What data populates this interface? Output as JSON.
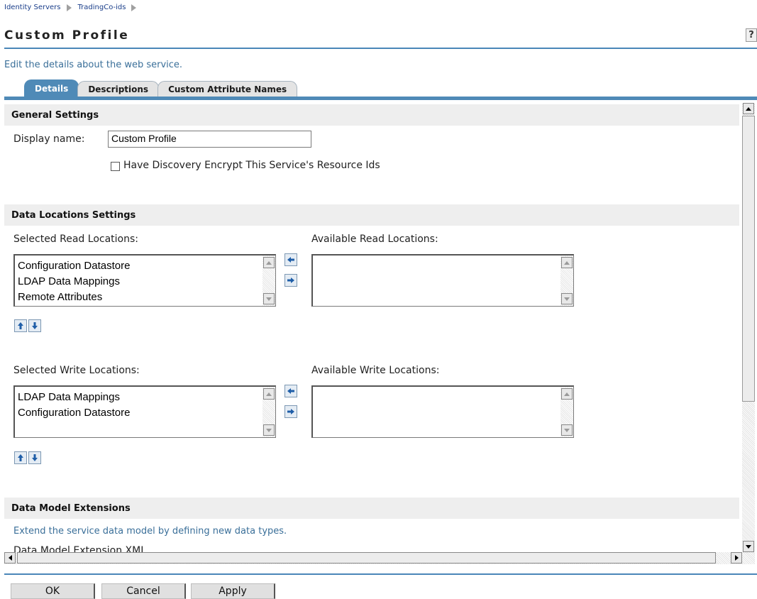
{
  "breadcrumb": {
    "items": [
      "Identity Servers",
      "TradingCo-ids"
    ]
  },
  "page": {
    "title": "Custom Profile",
    "help": "?",
    "intro": "Edit the details about the web service."
  },
  "tabs": [
    {
      "label": "Details",
      "active": true
    },
    {
      "label": "Descriptions",
      "active": false
    },
    {
      "label": "Custom Attribute Names",
      "active": false
    }
  ],
  "general": {
    "heading": "General Settings",
    "display_name_label": "Display name:",
    "display_name_value": "Custom Profile",
    "encrypt_label": "Have Discovery Encrypt This Service's Resource Ids",
    "encrypt_checked": false
  },
  "locations": {
    "heading": "Data Locations Settings",
    "selected_read_label": "Selected Read Locations:",
    "available_read_label": "Available Read Locations:",
    "selected_read": [
      "Configuration Datastore",
      "LDAP Data Mappings",
      "Remote Attributes"
    ],
    "available_read": [],
    "selected_write_label": "Selected Write Locations:",
    "available_write_label": "Available Write Locations:",
    "selected_write": [
      "LDAP Data Mappings",
      "Configuration Datastore"
    ],
    "available_write": []
  },
  "extensions": {
    "heading": "Data Model Extensions",
    "description": "Extend the service data model by defining new data types.",
    "partial_label": "Data Model Extension XML"
  },
  "footer": {
    "ok": "OK",
    "cancel": "Cancel",
    "apply": "Apply"
  },
  "colors": {
    "accent": "#4f8ab7",
    "link": "#3a6f99",
    "section_bg": "#eeeeee"
  }
}
